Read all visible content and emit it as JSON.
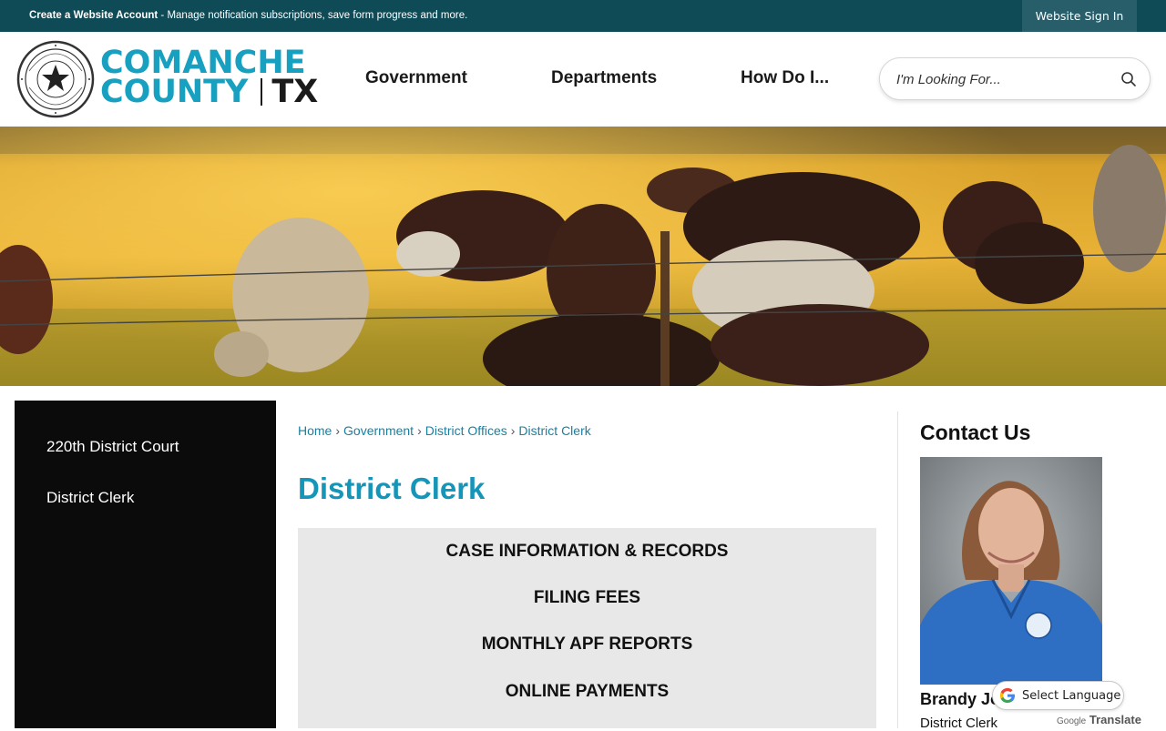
{
  "topbar": {
    "create_account": "Create a Website Account",
    "message": " - Manage notification subscriptions, save form progress and more.",
    "signin_label": "Website Sign In"
  },
  "header": {
    "logo_line1": "COMANCHE",
    "logo_line2": "COUNTY",
    "logo_state": "TX",
    "seal_text": "THE STATE OF TEXAS · COMANCHE COUNTY",
    "nav": [
      "Government",
      "Departments",
      "How Do I..."
    ],
    "search_placeholder": "I'm Looking For..."
  },
  "sidebar": {
    "items": [
      {
        "label": "220th District Court"
      },
      {
        "label": "District Clerk"
      }
    ]
  },
  "breadcrumb": [
    "Home",
    "Government",
    "District Offices",
    "District Clerk"
  ],
  "page_title": "District Clerk",
  "menu": [
    "CASE INFORMATION & RECORDS",
    "FILING FEES",
    "MONTHLY APF REPORTS",
    "ONLINE PAYMENTS"
  ],
  "contact": {
    "title": "Contact Us",
    "name": "Brandy Jo",
    "role": "District Clerk"
  },
  "translate": {
    "label": "Select Language",
    "powered_google": "Google",
    "powered_translate": "Translate"
  },
  "colors": {
    "topbar": "#0f4b57",
    "accent": "#1596b9",
    "sidebar": "#0b0b0c"
  }
}
